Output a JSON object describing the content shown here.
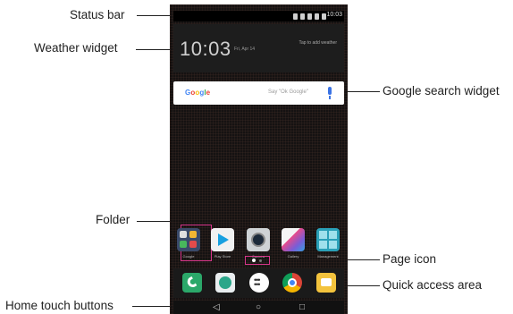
{
  "callouts": {
    "status_bar": "Status bar",
    "weather_widget": "Weather widget",
    "google_search_widget": "Google search widget",
    "folder": "Folder",
    "page_icon": "Page icon",
    "quick_access_area": "Quick access area",
    "home_touch_buttons": "Home touch buttons"
  },
  "status_bar": {
    "time": "10:03"
  },
  "weather": {
    "time": "10:03",
    "date": "Fri, Apr 14",
    "tap_hint": "Tap to add weather"
  },
  "search": {
    "logo": "Google",
    "hint": "Say \"Ok Google\""
  },
  "apps": [
    {
      "label": "Google",
      "icon": "folder-icon"
    },
    {
      "label": "Play Store",
      "icon": "play-store-icon"
    },
    {
      "label": "Camera",
      "icon": "camera-icon"
    },
    {
      "label": "Gallery",
      "icon": "gallery-icon"
    },
    {
      "label": "Management",
      "icon": "management-icon"
    }
  ],
  "quick_access": [
    {
      "icon": "phone-icon",
      "color": "#2ba86a"
    },
    {
      "icon": "contacts-icon",
      "color": "#e9eef0"
    },
    {
      "icon": "apps-drawer-icon",
      "color": "#ffffff"
    },
    {
      "icon": "chrome-icon",
      "color": "#db4437"
    },
    {
      "icon": "messages-icon",
      "color": "#f3c33d"
    }
  ],
  "nav": {
    "back": "◁",
    "home": "○",
    "recents": "□"
  },
  "colors": {
    "highlight": "#d7358a",
    "screen": "#151212"
  }
}
